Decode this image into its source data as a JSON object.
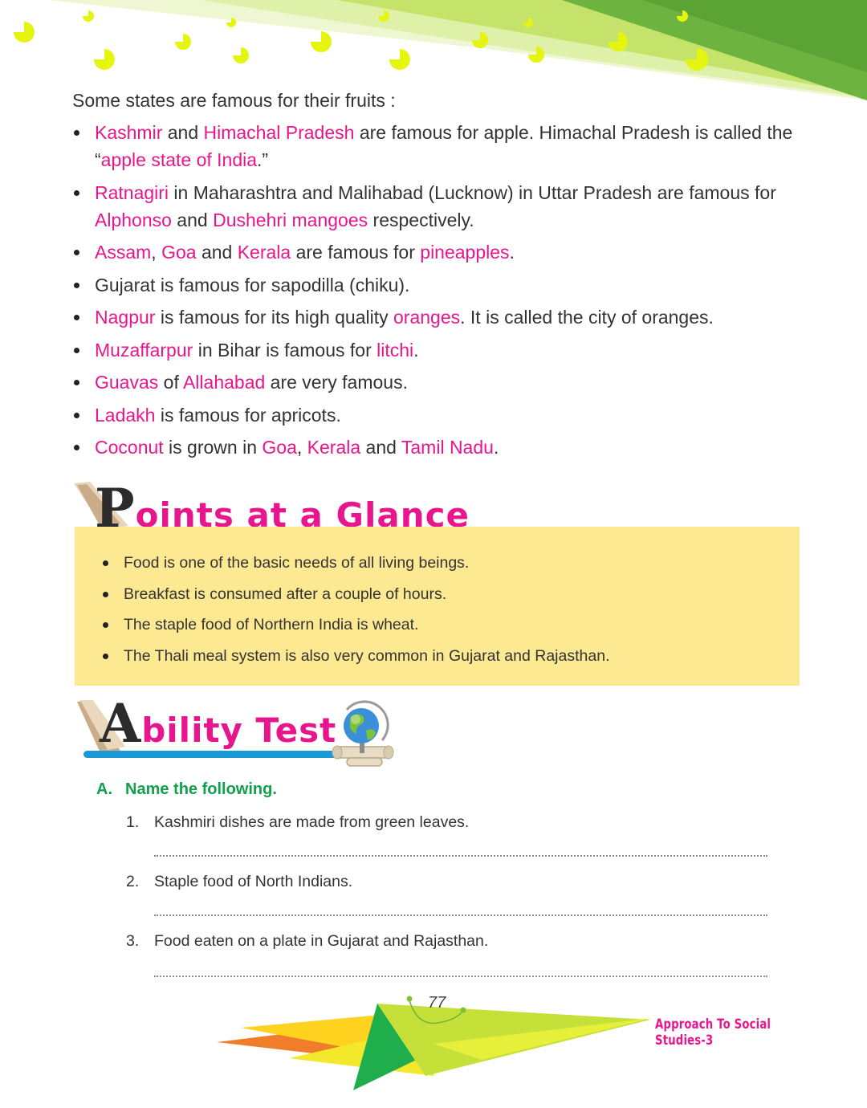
{
  "intro": "Some states are famous for their fruits :",
  "fruit_items": [
    {
      "parts": [
        {
          "t": "Kashmir",
          "h": true
        },
        {
          "t": " and ",
          "h": false
        },
        {
          "t": "Himachal Pradesh",
          "h": true
        },
        {
          "t": " are famous for apple. Himachal Pradesh is called the “",
          "h": false
        },
        {
          "t": "apple state of India",
          "h": true
        },
        {
          "t": ".”",
          "h": false
        }
      ]
    },
    {
      "parts": [
        {
          "t": "Ratnagiri",
          "h": true
        },
        {
          "t": " in Maharashtra and Malihabad (Lucknow) in Uttar Pradesh are famous for ",
          "h": false
        },
        {
          "t": "Alphonso",
          "h": true
        },
        {
          "t": " and ",
          "h": false
        },
        {
          "t": "Dushehri mangoes",
          "h": true
        },
        {
          "t": " respectively.",
          "h": false
        }
      ]
    },
    {
      "parts": [
        {
          "t": "Assam",
          "h": true
        },
        {
          "t": ", ",
          "h": false
        },
        {
          "t": "Goa",
          "h": true
        },
        {
          "t": " and ",
          "h": false
        },
        {
          "t": "Kerala",
          "h": true
        },
        {
          "t": " are famous for ",
          "h": false
        },
        {
          "t": "pineapples",
          "h": true
        },
        {
          "t": ".",
          "h": false
        }
      ]
    },
    {
      "parts": [
        {
          "t": "Gujarat is famous for sapodilla (chiku).",
          "h": false
        }
      ]
    },
    {
      "parts": [
        {
          "t": "Nagpur",
          "h": true
        },
        {
          "t": " is famous for its high quality ",
          "h": false
        },
        {
          "t": "oranges",
          "h": true
        },
        {
          "t": ". It is called the city of oranges.",
          "h": false
        }
      ]
    },
    {
      "parts": [
        {
          "t": "Muzaffarpur",
          "h": true
        },
        {
          "t": " in Bihar is famous for ",
          "h": false
        },
        {
          "t": "litchi",
          "h": true
        },
        {
          "t": ".",
          "h": false
        }
      ]
    },
    {
      "parts": [
        {
          "t": "Guavas",
          "h": true
        },
        {
          "t": " of ",
          "h": false
        },
        {
          "t": "Allahabad",
          "h": true
        },
        {
          "t": " are very famous.",
          "h": false
        }
      ]
    },
    {
      "parts": [
        {
          "t": "Ladakh",
          "h": true
        },
        {
          "t": " is famous for apricots.",
          "h": false
        }
      ]
    },
    {
      "parts": [
        {
          "t": "Coconut",
          "h": true
        },
        {
          "t": " is grown in ",
          "h": false
        },
        {
          "t": "Goa",
          "h": true
        },
        {
          "t": ", ",
          "h": false
        },
        {
          "t": "Kerala",
          "h": true
        },
        {
          "t": " and ",
          "h": false
        },
        {
          "t": "Tamil Nadu",
          "h": true
        },
        {
          "t": ".",
          "h": false
        }
      ]
    }
  ],
  "glance_heading": {
    "first": "P",
    "rest": "oints at a Glance"
  },
  "glance_points": [
    "Food is one of the basic needs of all living beings.",
    "Breakfast is consumed after a couple of hours.",
    "The staple food of Northern India is wheat.",
    "The Thali meal system is also very common in Gujarat and Rajasthan."
  ],
  "ability_heading": {
    "first": "A",
    "rest": "bility Test"
  },
  "section_a": {
    "letter": "A.",
    "title": "Name the following."
  },
  "questions": [
    {
      "num": "1.",
      "text": "Kashmiri dishes are made from green leaves."
    },
    {
      "num": "2.",
      "text": "Staple food of North Indians."
    },
    {
      "num": "3.",
      "text": "Food eaten on a plate in Gujarat and Rajasthan."
    }
  ],
  "page_number": "77",
  "book_title": "Approach To Social Studies-3",
  "colors": {
    "highlight": "#e8168c",
    "glance_bg": "#fde992",
    "section_green": "#11a04c",
    "heading_pink": "#e8168c"
  },
  "icons": [
    "globe-icon",
    "scroll-icon"
  ]
}
